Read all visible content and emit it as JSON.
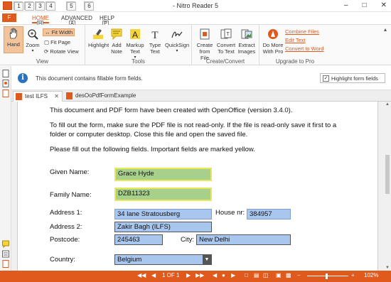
{
  "app": {
    "title": "- Nitro Reader 5",
    "qat_keys": [
      "1",
      "2",
      "3",
      "4",
      "5",
      "6"
    ],
    "file_key": "F",
    "window_controls": [
      "–",
      "□",
      "✕"
    ]
  },
  "ribbon_tabs": {
    "home": "HOME",
    "home_key": "H",
    "advanced": "ADVANCED",
    "advanced_key": "A",
    "help": "HELP",
    "help_key": "P"
  },
  "ribbon": {
    "view": {
      "label": "View",
      "hand": "Hand",
      "zoom": "Zoom",
      "fit_width": "Fit Width",
      "fit_page": "Fit Page",
      "rotate_view": "Rotate View"
    },
    "tools": {
      "label": "Tools",
      "highlight": "Highlight",
      "add_note": "Add Note",
      "markup_text": "Markup Text",
      "type_text": "Type Text",
      "quicksign": "QuickSign"
    },
    "create_convert": {
      "label": "Create/Convert",
      "create_from_file": "Create from File",
      "convert_to_text": "Convert To Text",
      "extract_images": "Extract Images"
    },
    "upgrade": {
      "label": "Upgrade to Pro",
      "do_more": "Do More With Pro",
      "combine_files": "Combine Files",
      "edit_text": "Edit Text",
      "convert_to_word": "Convert to Word"
    }
  },
  "notification": {
    "message": "This document contains fillable form fields.",
    "highlight_label": "Highlight form fields",
    "highlight_checked": "✓"
  },
  "doc_tabs": [
    {
      "label": "test ILFS",
      "close": "✕"
    },
    {
      "label": "desOoPdfFormExample"
    }
  ],
  "document": {
    "paragraphs": [
      "This document and PDF form have been created with OpenOffice (version 3.4.0).",
      "To fill out the form, make sure the PDF file is not read-only. If the file is read-only save it first to a",
      "folder or computer desktop. Close this file and open the saved file.",
      "Please fill out the following fields. Important fields are marked yellow."
    ],
    "fields": {
      "given_name": {
        "label": "Given Name:",
        "value": "Grace Hyde"
      },
      "family_name": {
        "label": "Family Name:",
        "value": "DZB11323"
      },
      "address1": {
        "label": "Address 1:",
        "value": "34 lane Stratousberg"
      },
      "house_nr": {
        "label": "House nr:",
        "value": "384957"
      },
      "address2": {
        "label": "Address 2:",
        "value": "Zakir Bagh (ILFS)"
      },
      "postcode": {
        "label": "Postcode:",
        "value": "245463"
      },
      "city": {
        "label": "City:",
        "value": "New Delhi"
      },
      "country": {
        "label": "Country:",
        "value": "Belgium"
      }
    }
  },
  "statusbar": {
    "page_indicator": "1 OF 1",
    "zoom": "102%"
  }
}
